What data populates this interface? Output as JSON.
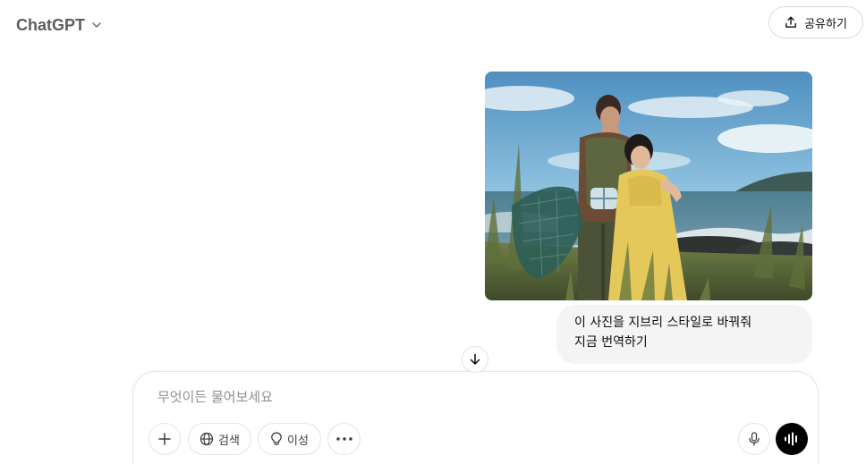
{
  "header": {
    "model_name": "ChatGPT",
    "share_label": "공유하기"
  },
  "conversation": {
    "user_image": {
      "icon": "photo-couple-by-sea"
    },
    "user_message": {
      "lines": [
        "이 사진을 지브리 스타일로 바꿔줘",
        "지금 번역하기"
      ]
    }
  },
  "composer": {
    "placeholder": "무엇이든 물어보세요",
    "value": "",
    "tools": {
      "search_label": "검색",
      "reason_label": "이성"
    }
  },
  "colors": {
    "bubble_bg": "#f4f4f4",
    "border": "#e3e3e3",
    "voice_button": "#000000",
    "model_name": "#5d5d5d"
  }
}
